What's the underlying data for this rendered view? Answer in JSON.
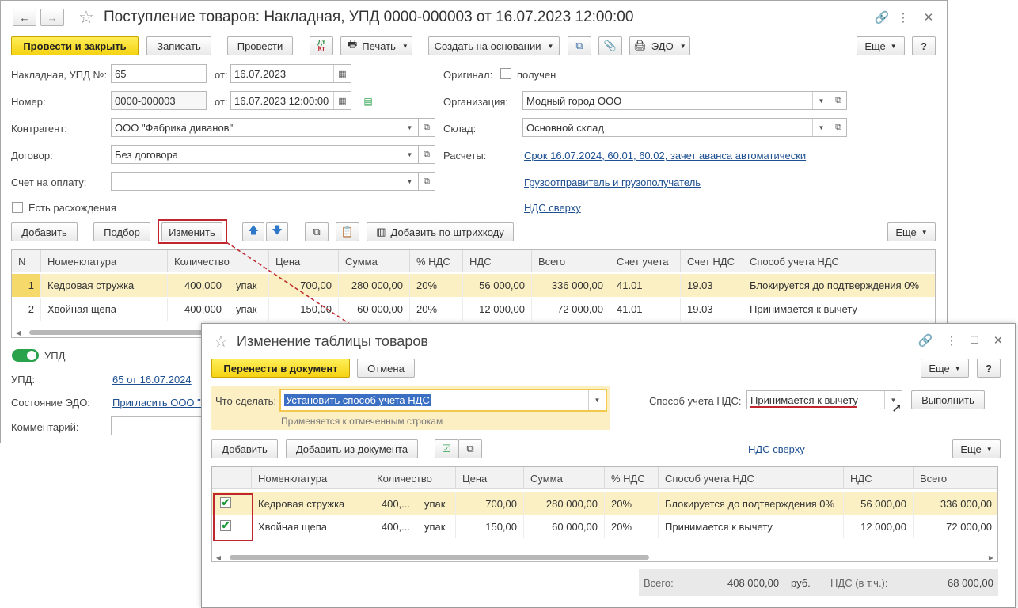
{
  "main": {
    "title": "Поступление товаров: Накладная, УПД 0000-000003 от 16.07.2023 12:00:00",
    "toolbar": {
      "post_close": "Провести и закрыть",
      "save": "Записать",
      "post": "Провести",
      "dt_kt": "Дт Кт",
      "print": "Печать",
      "create_based": "Создать на основании",
      "edo": "ЭДО",
      "more": "Еще",
      "help": "?"
    },
    "fields": {
      "invoice_label": "Накладная, УПД №:",
      "invoice_value": "65",
      "from_label": "от:",
      "invoice_date": "16.07.2023",
      "number_label": "Номер:",
      "number_value": "0000-000003",
      "number_date": "16.07.2023 12:00:00",
      "counterparty_label": "Контрагент:",
      "counterparty_value": "ООО \"Фабрика диванов\"",
      "contract_label": "Договор:",
      "contract_value": "Без договора",
      "payment_label": "Счет на оплату:",
      "payment_value": "",
      "discrepancy_label": "Есть расхождения",
      "original_label": "Оригинал:",
      "original_received": "получен",
      "org_label": "Организация:",
      "org_value": "Модный город ООО",
      "warehouse_label": "Склад:",
      "warehouse_value": "Основной склад",
      "settlements_label": "Расчеты:",
      "settlements_link": "Срок 16.07.2024, 60.01, 60.02, зачет аванса автоматически",
      "shipper_link": "Грузоотправитель и грузополучатель",
      "vat_top_link": "НДС сверху"
    },
    "table_toolbar": {
      "add": "Добавить",
      "selection": "Подбор",
      "change": "Изменить",
      "barcode": "Добавить по штрихкоду",
      "more": "Еще"
    },
    "table": {
      "headers": [
        "N",
        "Номенклатура",
        "Количество",
        "Цена",
        "Сумма",
        "% НДС",
        "НДС",
        "Всего",
        "Счет учета",
        "Счет НДС",
        "Способ учета НДС"
      ],
      "rows": [
        {
          "n": "1",
          "item": "Кедровая стружка",
          "qty": "400,000",
          "unit": "упак",
          "price": "700,00",
          "sum": "280 000,00",
          "vat_rate": "20%",
          "vat": "56 000,00",
          "total": "336 000,00",
          "account": "41.01",
          "vat_account": "19.03",
          "vat_method": "Блокируется до подтверждения 0%"
        },
        {
          "n": "2",
          "item": "Хвойная щепа",
          "qty": "400,000",
          "unit": "упак",
          "price": "150,00",
          "sum": "60 000,00",
          "vat_rate": "20%",
          "vat": "12 000,00",
          "total": "72 000,00",
          "account": "41.01",
          "vat_account": "19.03",
          "vat_method": "Принимается к вычету"
        }
      ]
    },
    "footer": {
      "upd_toggle": "УПД",
      "upd_label": "УПД:",
      "upd_link": "65 от 16.07.2024",
      "edo_label": "Состояние ЭДО:",
      "edo_link": "Пригласить ООО \"Ф",
      "comment_label": "Комментарий:"
    }
  },
  "dialog": {
    "title": "Изменение таблицы товаров",
    "transfer": "Перенести в документ",
    "cancel": "Отмена",
    "more": "Еще",
    "help": "?",
    "action_label": "Что сделать:",
    "action_value": "Установить способ учета НДС",
    "action_hint": "Применяется к отмеченным строкам",
    "vat_method_label": "Способ учета НДС:",
    "vat_method_value": "Принимается к вычету",
    "execute": "Выполнить",
    "add": "Добавить",
    "add_from_doc": "Добавить из документа",
    "vat_top_link": "НДС сверху",
    "table_more": "Еще",
    "table": {
      "headers": [
        "",
        "Номенклатура",
        "Количество",
        "Цена",
        "Сумма",
        "% НДС",
        "Способ учета НДС",
        "НДС",
        "Всего"
      ],
      "rows": [
        {
          "checked": true,
          "item": "Кедровая стружка",
          "qty": "400,...",
          "unit": "упак",
          "price": "700,00",
          "sum": "280 000,00",
          "vat_rate": "20%",
          "vat_method": "Блокируется до подтверждения 0%",
          "vat": "56 000,00",
          "total": "336 000,00"
        },
        {
          "checked": true,
          "item": "Хвойная щепа",
          "qty": "400,...",
          "unit": "упак",
          "price": "150,00",
          "sum": "60 000,00",
          "vat_rate": "20%",
          "vat_method": "Принимается к вычету",
          "vat": "12 000,00",
          "total": "72 000,00"
        }
      ]
    },
    "totals": {
      "total_label": "Всего:",
      "total_value": "408 000,00",
      "currency": "руб.",
      "vat_label": "НДС (в т.ч.):",
      "vat_value": "68 000,00"
    }
  },
  "colors": {
    "accent_yellow": "#f5d313",
    "highlight_row": "#fbf0c4",
    "link": "#1d4f91",
    "annotation_red": "#c0262d",
    "toggle_green": "#2aa24b"
  }
}
